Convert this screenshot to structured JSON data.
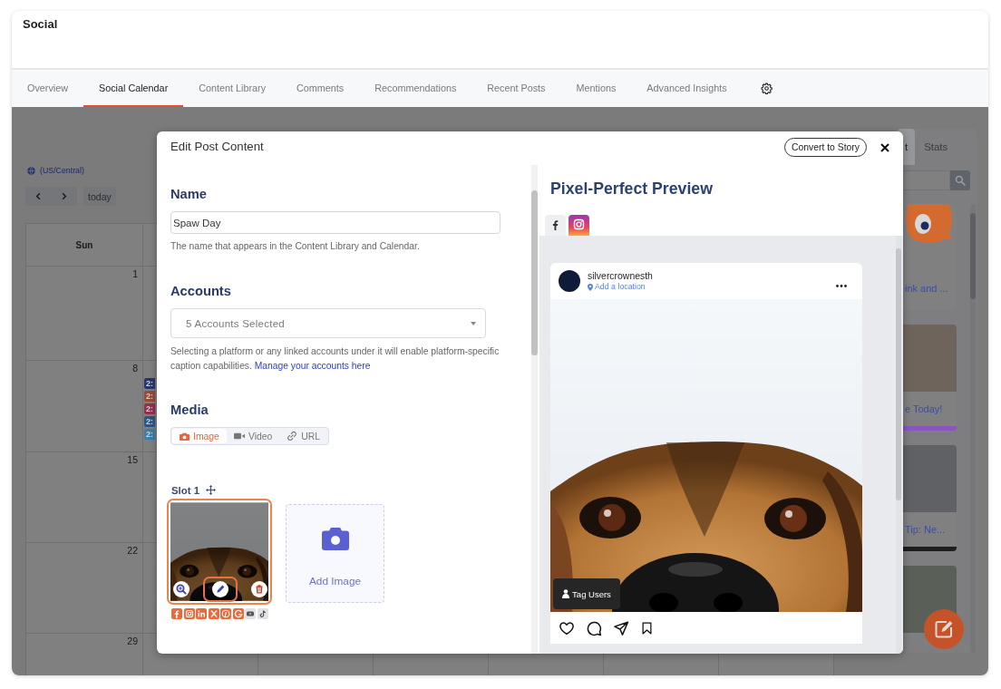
{
  "header": {
    "title": "Social"
  },
  "tabs": [
    {
      "label": "Overview",
      "selected": false
    },
    {
      "label": "Social Calendar",
      "selected": true
    },
    {
      "label": "Content Library",
      "selected": false
    },
    {
      "label": "Comments",
      "selected": false
    },
    {
      "label": "Recommendations",
      "selected": false
    },
    {
      "label": "Recent Posts",
      "selected": false
    },
    {
      "label": "Mentions",
      "selected": false
    },
    {
      "label": "Advanced Insights",
      "selected": false
    }
  ],
  "calendar": {
    "timezone": "(US/Central)",
    "today_button": "today",
    "weekday": "Sun",
    "weeks": [
      {
        "sun": "1"
      },
      {
        "sun": "8",
        "mon_events": [
          {
            "time": "2:",
            "color": "#27356f"
          },
          {
            "time": "2:",
            "color": "#9a4a36"
          },
          {
            "time": "2:",
            "color": "#94304f"
          },
          {
            "time": "2:",
            "color": "#2b5584"
          },
          {
            "time": "2:",
            "color": "#3b7ea9"
          }
        ]
      },
      {
        "sun": "15"
      },
      {
        "sun": "22"
      },
      {
        "sun": "29"
      }
    ]
  },
  "side_panel": {
    "tabs": [
      {
        "label": "t",
        "selected": true
      },
      {
        "label": "Stats",
        "selected": false
      }
    ],
    "cards": [
      {
        "kind": "cartoon",
        "caption": "ink and ..."
      },
      {
        "kind": "dog",
        "caption": "e Today!",
        "color": "#8a55c0"
      },
      {
        "kind": "person",
        "caption": "Tip: Ne...",
        "color": "#1e1e1e"
      },
      {
        "kind": "plants"
      }
    ]
  },
  "modal": {
    "title": "Edit Post Content",
    "story_button": "Convert to Story",
    "name_field": {
      "label": "Name",
      "value": "Spaw Day",
      "help": "The name that appears in the Content Library and Calendar."
    },
    "accounts": {
      "label": "Accounts",
      "value": "5 Accounts Selected",
      "help": "Selecting a platform or any linked accounts under it will enable platform-specific caption capabilities.",
      "link": "Manage your accounts here"
    },
    "media": {
      "label": "Media",
      "types": [
        {
          "kind": "image",
          "label": "Image",
          "selected": true
        },
        {
          "kind": "video",
          "label": "Video",
          "selected": false
        },
        {
          "kind": "url",
          "label": "URL",
          "selected": false
        }
      ],
      "slot": {
        "label": "Slot 1",
        "highlighted": true,
        "actions": [
          {
            "kind": "zoom",
            "highlighted": false
          },
          {
            "kind": "edit",
            "highlighted": true
          },
          {
            "kind": "delete",
            "highlighted": false
          }
        ],
        "platforms": [
          {
            "kind": "facebook",
            "enabled": true
          },
          {
            "kind": "instagram",
            "enabled": true
          },
          {
            "kind": "linkedin",
            "enabled": true
          },
          {
            "kind": "x",
            "enabled": true
          },
          {
            "kind": "pinterest",
            "enabled": true
          },
          {
            "kind": "google",
            "enabled": true
          },
          {
            "kind": "youtube",
            "enabled": false
          },
          {
            "kind": "tiktok",
            "enabled": false
          }
        ]
      },
      "add_image": "Add Image"
    },
    "preview": {
      "title": "Pixel-Perfect Preview",
      "platforms": [
        {
          "kind": "facebook",
          "selected": false
        },
        {
          "kind": "instagram",
          "selected": true
        }
      ],
      "post": {
        "username": "silvercrownesth",
        "location": "Add a location",
        "tag_button": "Tag Users"
      }
    }
  }
}
